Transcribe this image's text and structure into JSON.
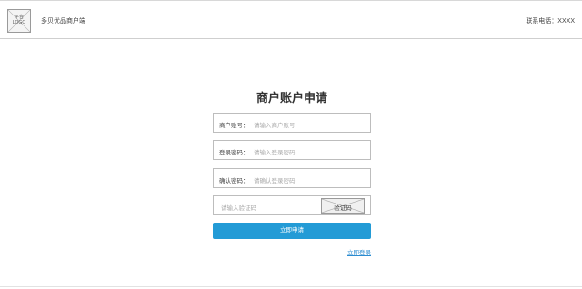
{
  "header": {
    "logo_text": "平台\nLOGO",
    "site_name": "多贝优品商户端",
    "contact": "联系电话：XXXX"
  },
  "form": {
    "title": "商户账户申请",
    "account": {
      "label": "商户账号：",
      "placeholder": "请输入商户账号"
    },
    "password": {
      "label": "登录密码：",
      "placeholder": "请输入登录密码"
    },
    "confirm": {
      "label": "确认密码：",
      "placeholder": "请确认登录密码"
    },
    "code": {
      "placeholder": "请输入验证码",
      "captcha_label": "验证码"
    },
    "submit_label": "立即申请",
    "login_link": "立即登录"
  }
}
